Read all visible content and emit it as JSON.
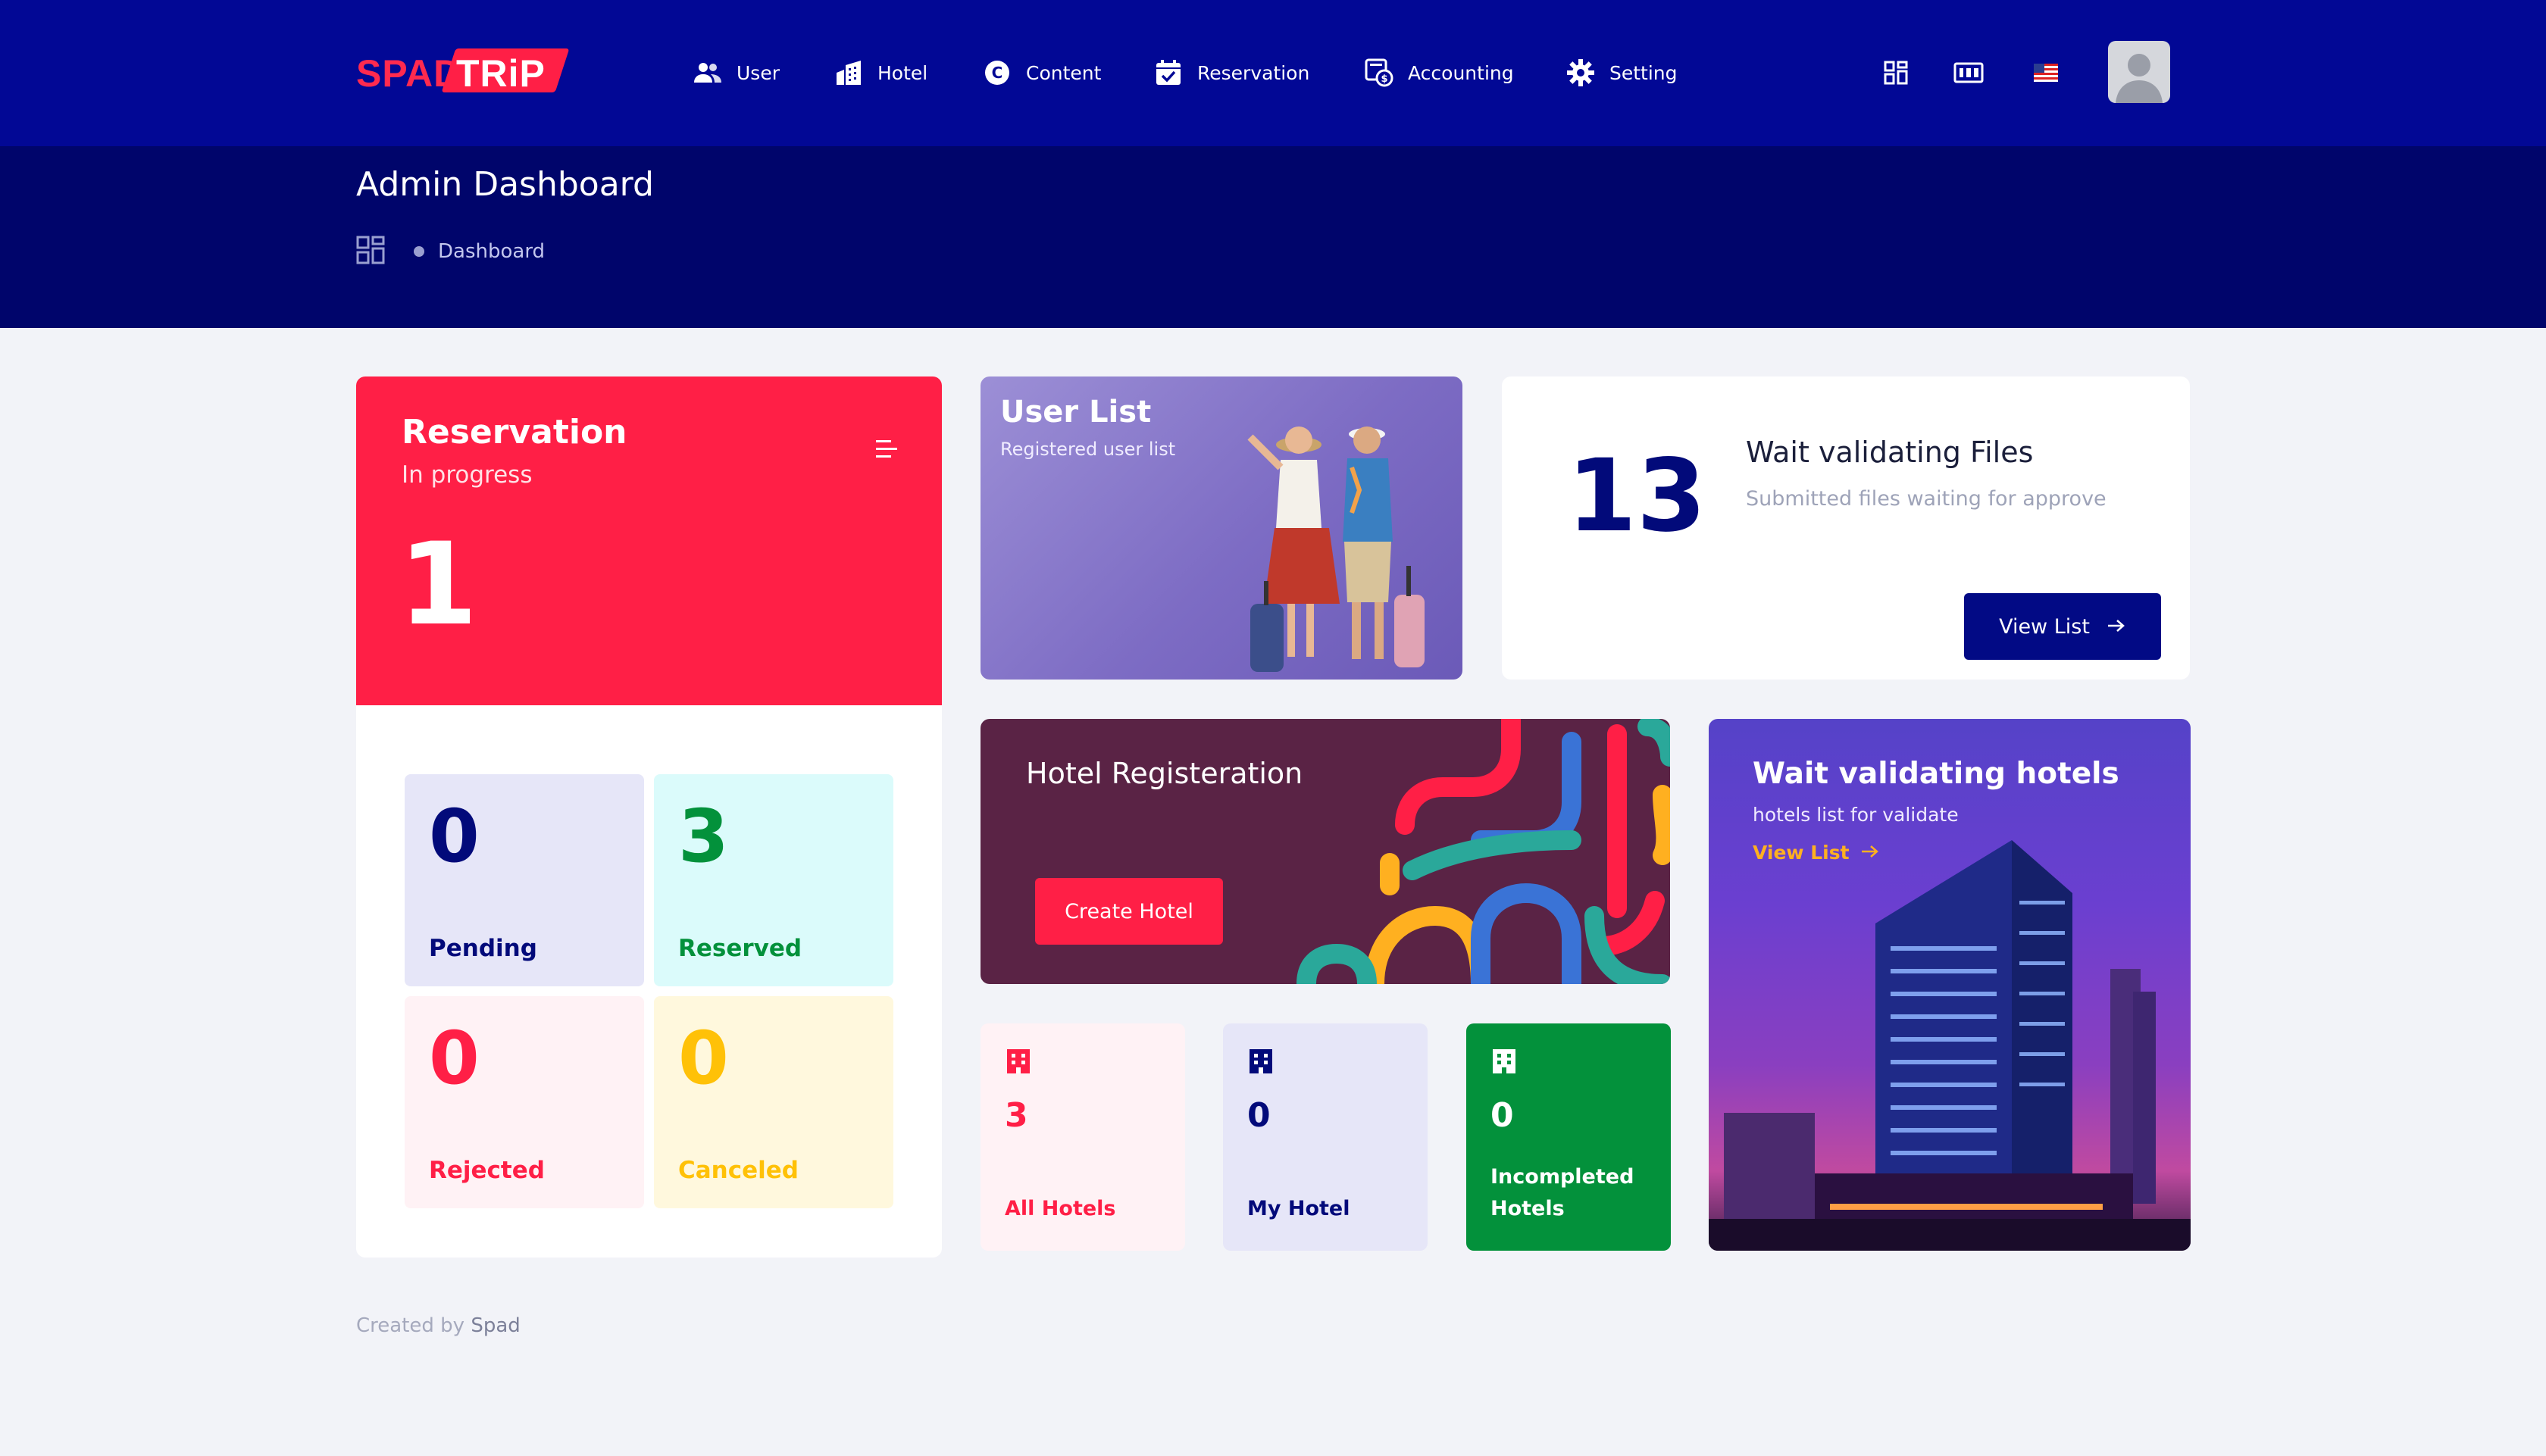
{
  "brand": {
    "part1": "SPAD",
    "part2": "TRiP"
  },
  "nav": [
    {
      "label": "User",
      "icon": "users-icon"
    },
    {
      "label": "Hotel",
      "icon": "building-icon"
    },
    {
      "label": "Content",
      "icon": "copyright-icon"
    },
    {
      "label": "Reservation",
      "icon": "calendar-check-icon"
    },
    {
      "label": "Accounting",
      "icon": "accounting-icon"
    },
    {
      "label": "Setting",
      "icon": "gear-icon"
    }
  ],
  "header": {
    "title": "Admin Dashboard",
    "breadcrumb": "Dashboard"
  },
  "reservation": {
    "title": "Reservation",
    "subtitle": "In progress",
    "count": "1",
    "tiles": [
      {
        "value": "0",
        "label": "Pending"
      },
      {
        "value": "3",
        "label": "Reserved"
      },
      {
        "value": "0",
        "label": "Rejected"
      },
      {
        "value": "0",
        "label": "Canceled"
      }
    ]
  },
  "user_list": {
    "title": "User List",
    "subtitle": "Registered user list"
  },
  "files": {
    "count": "13",
    "title": "Wait validating Files",
    "subtitle": "Submitted files waiting for approve",
    "button": "View List"
  },
  "hotel_registration": {
    "title": "Hotel Registeration",
    "button": "Create Hotel"
  },
  "hotel_stats": [
    {
      "value": "3",
      "label": "All Hotels"
    },
    {
      "value": "0",
      "label": "My Hotel"
    },
    {
      "value": "0",
      "label_line1": "Incompleted",
      "label_line2": "Hotels"
    }
  ],
  "validating_hotels": {
    "title": "Wait validating hotels",
    "subtitle": "hotels list for validate",
    "link": "View List"
  },
  "footer": {
    "prefix": "Created by",
    "author": "Spad"
  },
  "colors": {
    "navbar": "#020895",
    "subheader": "#00056b",
    "accent_red": "#ff1f46",
    "navy": "#020a85",
    "green": "#03913b",
    "yellow": "#ffc107"
  }
}
